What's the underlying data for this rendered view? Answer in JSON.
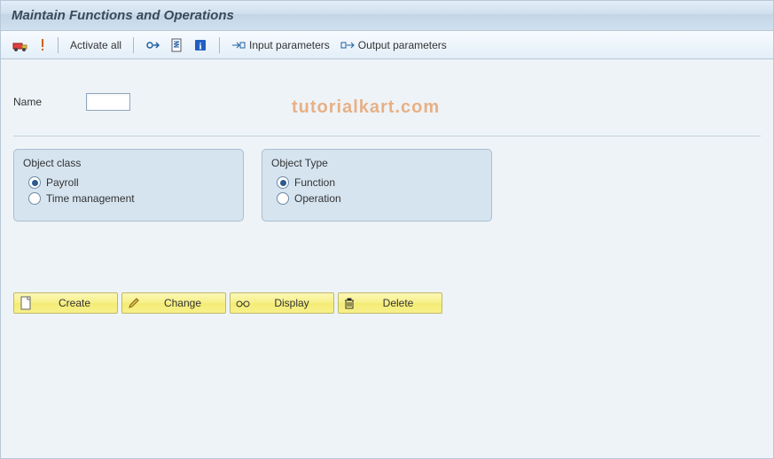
{
  "header": {
    "title": "Maintain Functions and Operations"
  },
  "toolbar": {
    "activate_all": "Activate all",
    "input_params": "Input parameters",
    "output_params": "Output parameters"
  },
  "form": {
    "name_label": "Name",
    "name_value": ""
  },
  "object_class": {
    "title": "Object class",
    "opt1": "Payroll",
    "opt2": "Time management",
    "selected": "Payroll"
  },
  "object_type": {
    "title": "Object Type",
    "opt1": "Function",
    "opt2": "Operation",
    "selected": "Function"
  },
  "buttons": {
    "create": "Create",
    "change": "Change",
    "display": "Display",
    "delete": "Delete"
  },
  "watermark": "tutorialkart.com"
}
